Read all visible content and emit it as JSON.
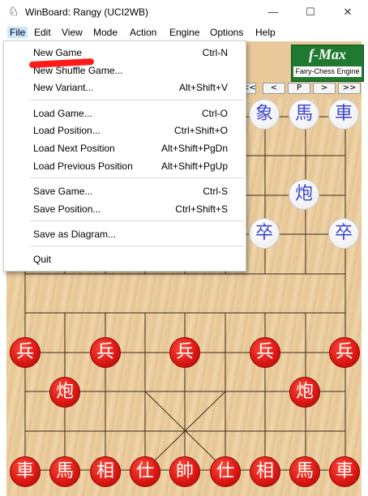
{
  "window": {
    "title": "WinBoard: Rangy (UCI2WB)",
    "app_icon": "chess-knight-icon",
    "controls": {
      "minimize": "—",
      "maximize": "☐",
      "close": "✕"
    }
  },
  "menubar": {
    "items": [
      "File",
      "Edit",
      "View",
      "Mode",
      "Action",
      "Engine",
      "Options",
      "Help"
    ],
    "active": "File"
  },
  "logo": {
    "title": "f-Max",
    "subtitle": "Fairy-Chess Engine"
  },
  "nav_buttons": [
    "<<",
    "<",
    "P",
    ">",
    ">>"
  ],
  "file_menu": {
    "items": [
      {
        "label": "New Game",
        "shortcut": "Ctrl-N"
      },
      {
        "label": "New Shuffle Game...",
        "shortcut": ""
      },
      {
        "label": "New Variant...",
        "shortcut": "Alt+Shift+V"
      },
      {
        "label": "Load Game...",
        "shortcut": "Ctrl-O"
      },
      {
        "label": "Load Position...",
        "shortcut": "Ctrl+Shift+O"
      },
      {
        "label": "Load Next Position",
        "shortcut": "Alt+Shift+PgDn"
      },
      {
        "label": "Load Previous Position",
        "shortcut": "Alt+Shift+PgUp"
      },
      {
        "label": "Save Game...",
        "shortcut": "Ctrl-S"
      },
      {
        "label": "Save Position...",
        "shortcut": "Ctrl+Shift+S"
      },
      {
        "label": "Save as Diagram...",
        "shortcut": ""
      },
      {
        "label": "Quit",
        "shortcut": ""
      }
    ]
  },
  "board": {
    "visible_black_pieces": [
      "象",
      "馬",
      "車",
      "炮",
      "卒",
      "卒"
    ],
    "red_pieces": {
      "soldiers": [
        "兵",
        "兵",
        "兵",
        "兵",
        "兵"
      ],
      "cannons": [
        "炮",
        "炮"
      ],
      "back_rank": [
        "車",
        "馬",
        "相",
        "仕",
        "帥",
        "仕",
        "相",
        "馬",
        "車"
      ]
    }
  },
  "colors": {
    "menu_highlight": "#cce8ff",
    "red_piece": "#d81510",
    "black_piece_text": "#3b43d0",
    "board": "#e9c99a",
    "annotation": "#ff1a1a"
  }
}
